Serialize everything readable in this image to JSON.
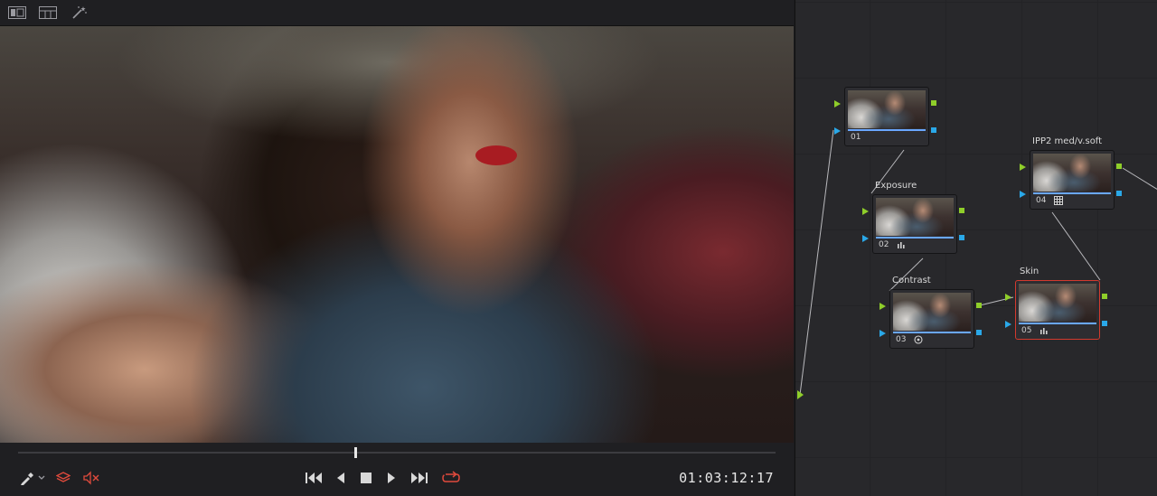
{
  "viewer": {
    "toolbar_icons": [
      "single-viewer-icon",
      "split-viewer-icon",
      "magic-wand-icon"
    ],
    "timecode": "01:03:12:17",
    "playhead_fraction": 0.445
  },
  "transport": {
    "icons": [
      "eyedropper-icon",
      "layers-icon",
      "audio-mute-icon",
      "skip-to-start-icon",
      "play-reverse-icon",
      "stop-icon",
      "play-icon",
      "skip-to-end-icon",
      "loop-icon"
    ]
  },
  "nodes": [
    {
      "id": "01",
      "label": "01",
      "title": "",
      "icon": ""
    },
    {
      "id": "02",
      "label": "02",
      "title": "Exposure",
      "icon": "bars-icon"
    },
    {
      "id": "03",
      "label": "03",
      "title": "Contrast",
      "icon": "circle-dot-icon"
    },
    {
      "id": "04",
      "label": "04",
      "title": "IPP2 med/v.soft",
      "icon": "grid-icon"
    },
    {
      "id": "05",
      "label": "05",
      "title": "Skin",
      "icon": "bars-icon"
    }
  ],
  "colors": {
    "accent_red": "#d33a2e",
    "node_bar_blue": "#6aa7ff",
    "port_green": "#8fce2a",
    "port_blue": "#2aa8e8"
  }
}
